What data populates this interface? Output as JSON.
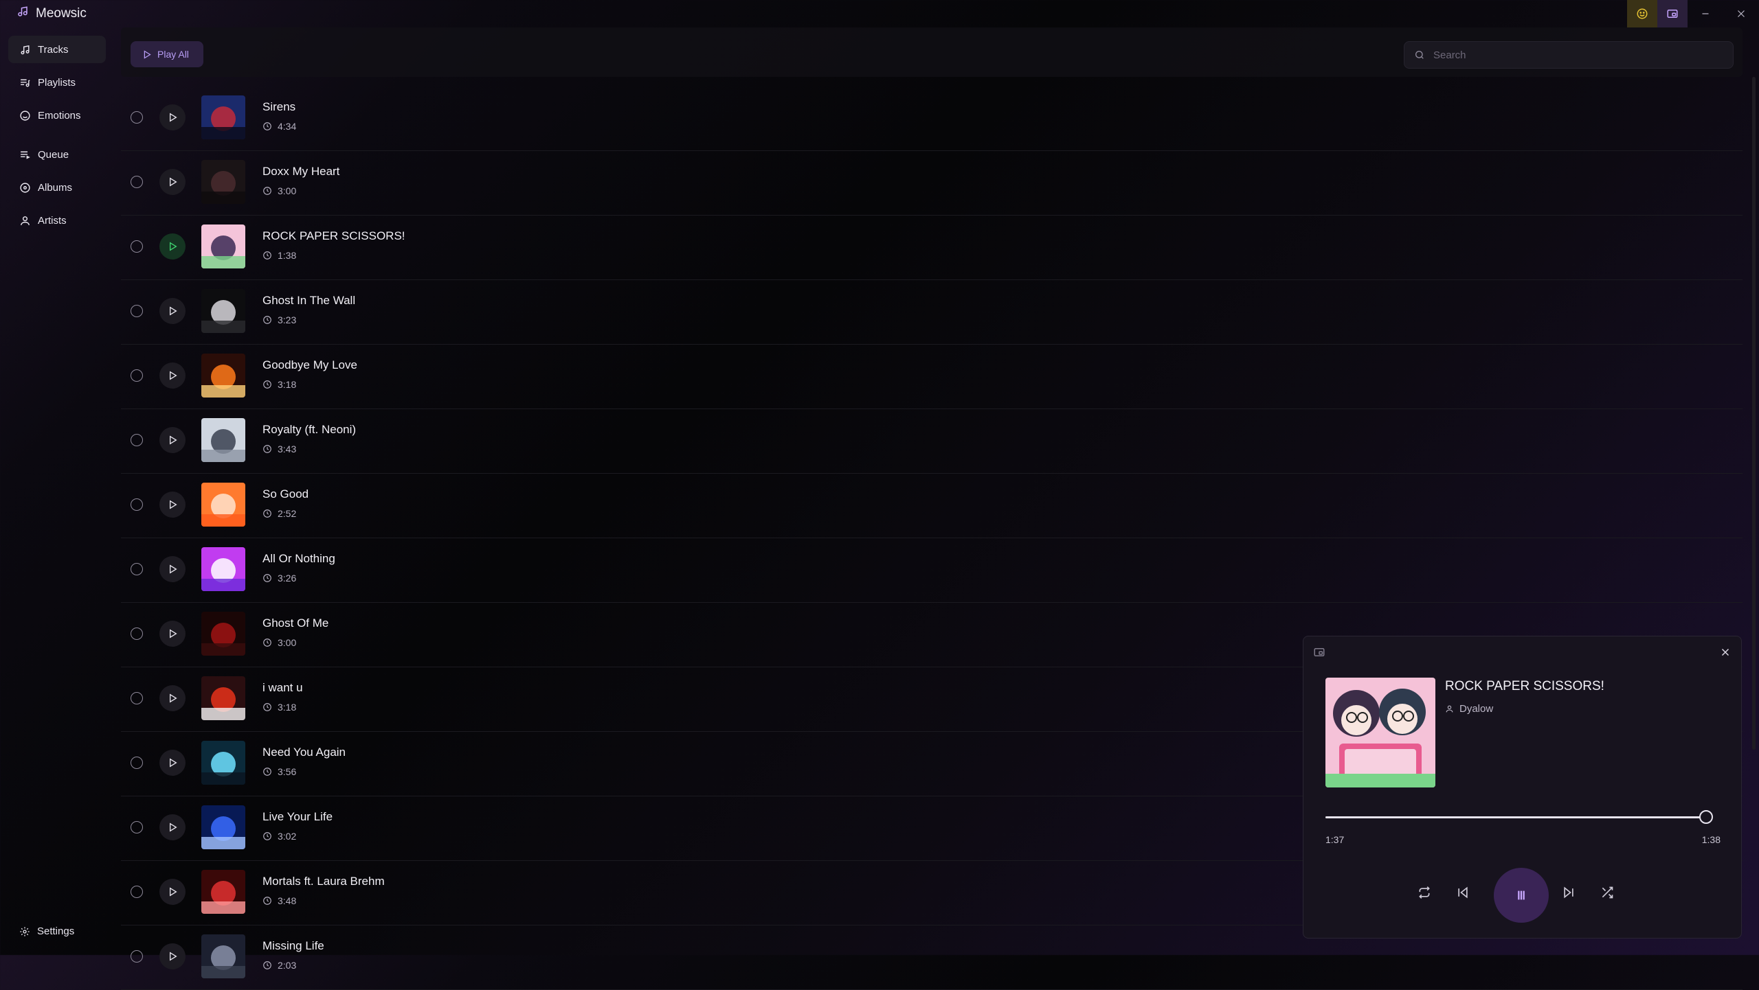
{
  "app": {
    "title": "Meowsic"
  },
  "colors": {
    "accent": "#b89ef5",
    "playing": "#3fd16f",
    "background": "#060608"
  },
  "sidebar": {
    "items": [
      {
        "label": "Tracks",
        "icon": "music-note-icon",
        "active": true
      },
      {
        "label": "Playlists",
        "icon": "playlist-icon"
      },
      {
        "label": "Emotions",
        "icon": "smile-icon"
      },
      {
        "label": "Queue",
        "icon": "queue-icon"
      },
      {
        "label": "Albums",
        "icon": "album-icon"
      },
      {
        "label": "Artists",
        "icon": "user-icon"
      }
    ],
    "settings_label": "Settings"
  },
  "toolbar": {
    "play_all_label": "Play All"
  },
  "search": {
    "placeholder": "Search",
    "value": ""
  },
  "tracks": [
    {
      "title": "Sirens",
      "duration": "4:34"
    },
    {
      "title": "Doxx My Heart",
      "duration": "3:00"
    },
    {
      "title": "ROCK PAPER SCISSORS!",
      "duration": "1:38",
      "playing": true
    },
    {
      "title": "Ghost In The Wall",
      "duration": "3:23"
    },
    {
      "title": "Goodbye My Love",
      "duration": "3:18"
    },
    {
      "title": "Royalty (ft. Neoni)",
      "duration": "3:43"
    },
    {
      "title": "So Good",
      "duration": "2:52"
    },
    {
      "title": "All Or Nothing",
      "duration": "3:26"
    },
    {
      "title": "Ghost Of Me",
      "duration": "3:00"
    },
    {
      "title": "i want u",
      "duration": "3:18"
    },
    {
      "title": "Need You Again",
      "duration": "3:56"
    },
    {
      "title": "Live Your Life",
      "duration": "3:02"
    },
    {
      "title": "Mortals ft. Laura Brehm",
      "duration": "3:48"
    },
    {
      "title": "Missing Life",
      "duration": "2:03"
    }
  ],
  "player": {
    "title": "ROCK PAPER SCISSORS!",
    "artist": "Dyalow",
    "elapsed": "1:37",
    "total": "1:38",
    "progress": 0.99
  }
}
